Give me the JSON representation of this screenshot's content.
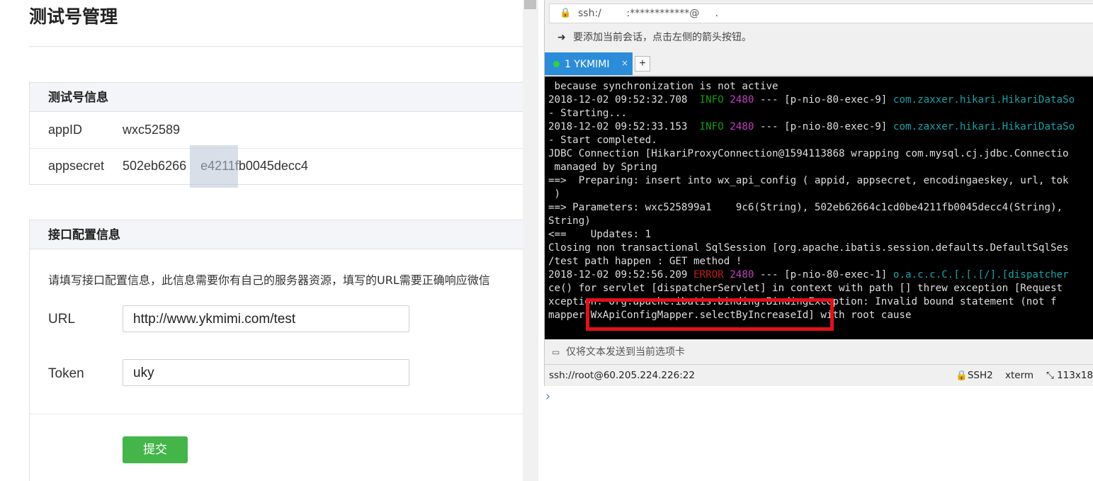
{
  "page": {
    "title": "测试号管理"
  },
  "info_panel": {
    "heading": "测试号信息",
    "appid_label": "appID",
    "appid_value": "wxc52589",
    "appsecret_label": "appsecret",
    "appsecret_value": "502eb6266    e4211fb0045decc4"
  },
  "api_panel": {
    "heading": "接口配置信息",
    "description": "请填写接口配置信息，此信息需要你有自己的服务器资源，填写的URL需要正确响应微信",
    "url_label": "URL",
    "url_value": "http://www.ykmimi.com/test",
    "token_label": "Token",
    "token_value": "uky",
    "submit_label": "提交"
  },
  "ssh_window": {
    "address": "ssh:/        :************@     .",
    "hint": "要添加当前会话，点击左侧的箭头按钮。",
    "tab_label": "1 YKMIMI",
    "tab_close": "×",
    "tab_add": "+",
    "terminal": {
      "lines": [
        [
          {
            "t": " because synchronization is not active"
          }
        ],
        [
          {
            "t": "2018-12-02 09:52:32.708  "
          },
          {
            "t": "INFO",
            "c": "green"
          },
          {
            "t": " "
          },
          {
            "t": "2480",
            "c": "mag"
          },
          {
            "t": " --- [p-nio-80-exec-9] "
          },
          {
            "t": "com.zaxxer.hikari.HikariDataSo",
            "c": "cyan"
          }
        ],
        [
          {
            "t": "- Starting..."
          }
        ],
        [
          {
            "t": "2018-12-02 09:52:33.153  "
          },
          {
            "t": "INFO",
            "c": "green"
          },
          {
            "t": " "
          },
          {
            "t": "2480",
            "c": "mag"
          },
          {
            "t": " --- [p-nio-80-exec-9] "
          },
          {
            "t": "com.zaxxer.hikari.HikariDataSo",
            "c": "cyan"
          }
        ],
        [
          {
            "t": "- Start completed."
          }
        ],
        [
          {
            "t": "JDBC Connection [HikariProxyConnection@1594113868 wrapping com.mysql.cj.jdbc.Connectio"
          }
        ],
        [
          {
            "t": " managed by Spring"
          }
        ],
        [
          {
            "t": "==>  Preparing: insert into wx_api_config ( appid, appsecret, encodingaeskey, url, tok"
          }
        ],
        [
          {
            "t": " )"
          }
        ],
        [
          {
            "t": "==> Parameters: wxc525899a1    9c6(String), 502eb62664c1cd0be4211fb0045decc4(String),"
          }
        ],
        [
          {
            "t": "String)"
          }
        ],
        [
          {
            "t": "<==    Updates: 1"
          }
        ],
        [
          {
            "t": "Closing non transactional SqlSession [org.apache.ibatis.session.defaults.DefaultSqlSes"
          }
        ],
        [
          {
            "t": "/test path happen : GET method !"
          }
        ],
        [
          {
            "t": "2018-12-02 09:52:56.209 "
          },
          {
            "t": "ERROR",
            "c": "red"
          },
          {
            "t": " "
          },
          {
            "t": "2480",
            "c": "mag"
          },
          {
            "t": " --- [p-nio-80-exec-1] "
          },
          {
            "t": "o.a.c.c.C.[.[.[/].[dispatcher",
            "c": "cyan"
          }
        ],
        [
          {
            "t": "ce() for servlet [dispatcherServlet] in context with path [] threw exception [Request"
          }
        ],
        [
          {
            "t": "xception: org.apache.ibatis.binding.BindingException: Invalid bound statement (not f"
          }
        ],
        [
          {
            "t": "mapper.WxApiConfigMapper.selectByIncreaseId] with root cause"
          }
        ]
      ]
    },
    "send_bar_text": "仅将文本发送到当前选项卡",
    "status": {
      "connection": "ssh://root@60.205.224.226:22",
      "protocol": "SSH2",
      "terminal_type": "xterm",
      "size": "113x18"
    }
  },
  "colors": {
    "submit_button": "#44b549",
    "tab_active": "#2b8cd9",
    "highlight_box": "#e1101a"
  }
}
